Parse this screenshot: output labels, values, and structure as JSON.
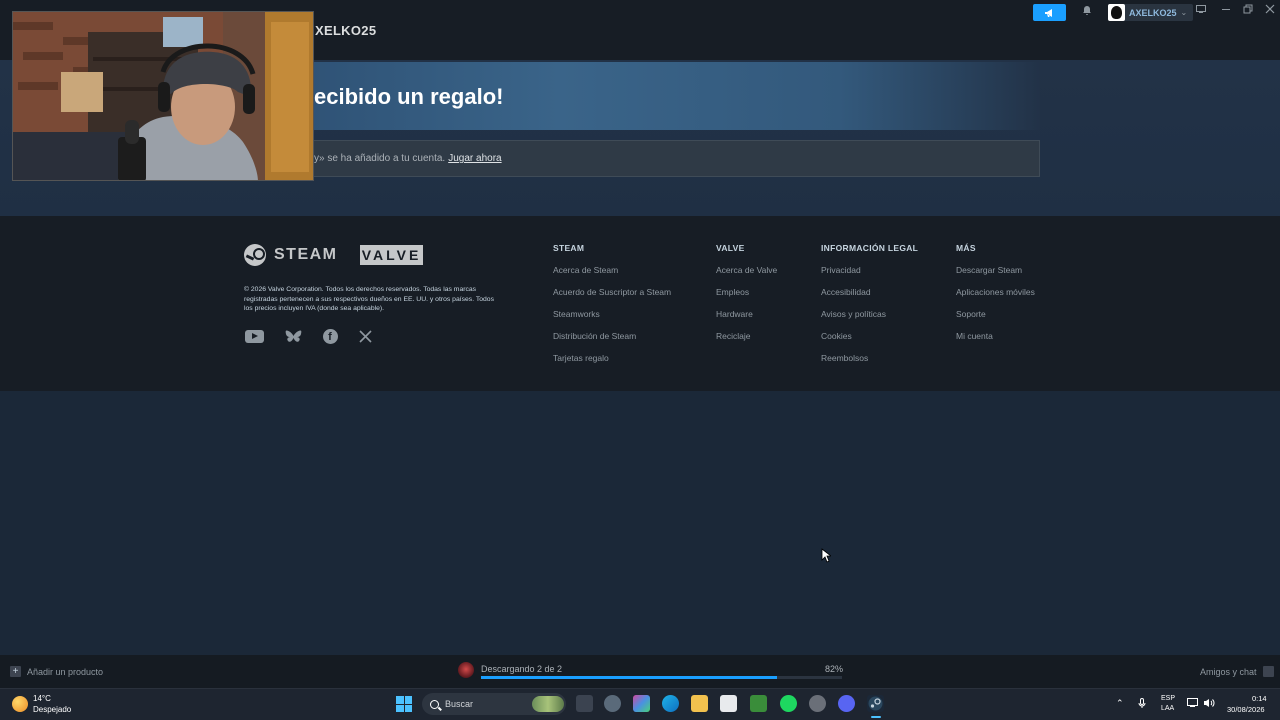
{
  "header": {
    "page_title": "XELKO25",
    "user_name": "AXELKO25",
    "colors": {
      "accent": "#1a9fff",
      "background": "#1b2838",
      "footer": "#171d25"
    }
  },
  "gift": {
    "title": "ecibido un regalo!",
    "message": "y» se ha añadido a tu cuenta.",
    "play_link": "Jugar ahora"
  },
  "footer": {
    "steam_word": "STEAM",
    "valve_word": "VALVE",
    "legal": "© 2026 Valve Corporation. Todos los derechos reservados. Todas las marcas registradas pertenecen a sus respectivos dueños en EE. UU. y otros países. Todos los precios incluyen IVA (donde sea aplicable).",
    "social_icons": [
      "youtube-icon",
      "bluesky-icon",
      "facebook-icon",
      "x-icon"
    ],
    "columns": [
      {
        "title": "STEAM",
        "links": [
          "Acerca de Steam",
          "Acuerdo de Suscriptor a Steam",
          "Steamworks",
          "Distribución de Steam",
          "Tarjetas regalo"
        ]
      },
      {
        "title": "VALVE",
        "links": [
          "Acerca de Valve",
          "Empleos",
          "Hardware",
          "Reciclaje"
        ]
      },
      {
        "title": "INFORMACIÓN LEGAL",
        "links": [
          "Privacidad",
          "Accesibilidad",
          "Avisos y políticas",
          "Cookies",
          "Reembolsos"
        ]
      },
      {
        "title": "MÁS",
        "links": [
          "Descargar Steam",
          "Aplicaciones móviles",
          "Soporte",
          "Mi cuenta"
        ]
      }
    ]
  },
  "statusbar": {
    "add_product": "Añadir un producto",
    "download_text": "Descargando 2 de 2",
    "download_percent": "82%",
    "download_fraction": 0.82,
    "friends_chat": "Amigos y chat"
  },
  "taskbar": {
    "temperature": "14°C",
    "weather": "Despejado",
    "search_label": "Buscar",
    "lang_line1": "ESP",
    "lang_line2": "LAA",
    "time": "0:14",
    "date": "30/08/2026"
  }
}
